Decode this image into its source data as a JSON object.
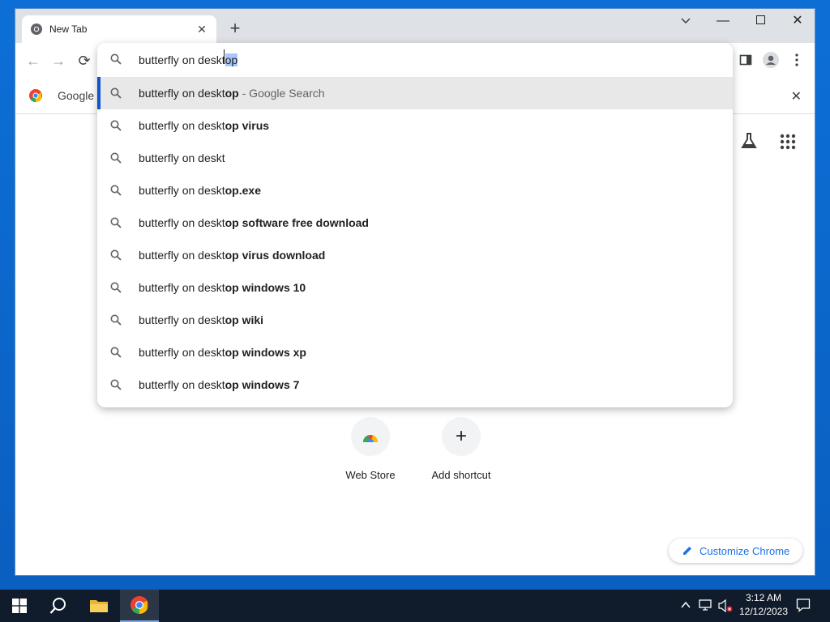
{
  "browser": {
    "tab_title": "New Tab",
    "bookmark_label": "Google C"
  },
  "omnibox": {
    "typed": "butterfly on deskt",
    "selected_completion": "op"
  },
  "suggestions": [
    {
      "plain": "butterfly on deskt",
      "bold": "op",
      "hint": " - Google Search"
    },
    {
      "plain": "butterfly on deskt",
      "bold": "op virus",
      "hint": ""
    },
    {
      "plain": "butterfly on deskt",
      "bold": "",
      "hint": ""
    },
    {
      "plain": "butterfly on deskt",
      "bold": "op.exe",
      "hint": ""
    },
    {
      "plain": "butterfly on deskt",
      "bold": "op software free download",
      "hint": ""
    },
    {
      "plain": "butterfly on deskt",
      "bold": "op virus download",
      "hint": ""
    },
    {
      "plain": "butterfly on deskt",
      "bold": "op windows 10",
      "hint": ""
    },
    {
      "plain": "butterfly on deskt",
      "bold": "op wiki",
      "hint": ""
    },
    {
      "plain": "butterfly on deskt",
      "bold": "op windows xp",
      "hint": ""
    },
    {
      "plain": "butterfly on deskt",
      "bold": "op windows 7",
      "hint": ""
    }
  ],
  "shortcuts": [
    {
      "label": "Web Store"
    },
    {
      "label": "Add shortcut"
    }
  ],
  "customize_label": "Customize Chrome",
  "taskbar": {
    "time": "3:12 AM",
    "date": "12/12/2023"
  },
  "colors": {
    "accent": "#1a73e8",
    "selection": "#a8c7fa",
    "active_row": "#e8e8e9",
    "desktop": "#0d6fd6"
  }
}
